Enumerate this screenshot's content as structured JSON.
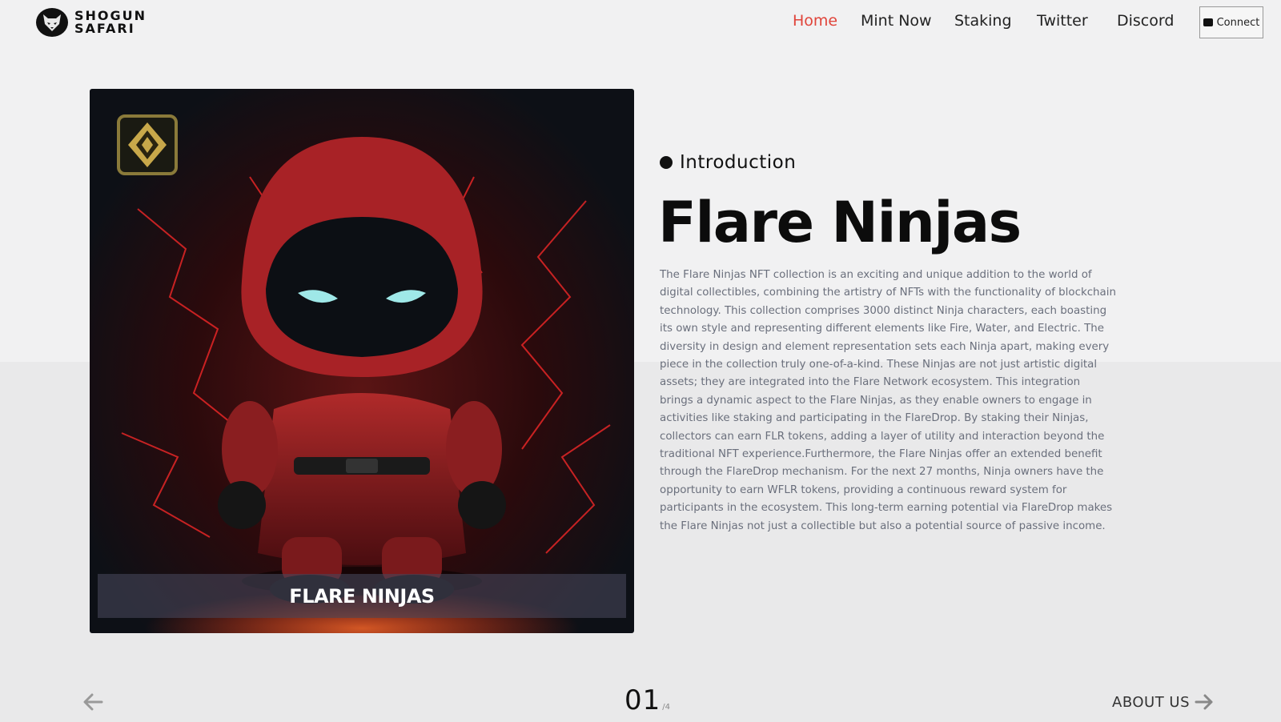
{
  "brand": {
    "line1": "SHOGUN",
    "line2": "SAFARI",
    "logo_icon": "fox-mask-icon"
  },
  "nav": {
    "items": [
      {
        "label": "Home",
        "active": true
      },
      {
        "label": "Mint Now",
        "active": false
      },
      {
        "label": "Staking",
        "active": false
      },
      {
        "label": "Twitter",
        "active": false
      },
      {
        "label": "Discord",
        "active": false
      }
    ],
    "connect_label": "Connect",
    "connect_icon": "wallet-icon",
    "active_color": "#e0443a"
  },
  "hero": {
    "caption": "FLARE NINJAS",
    "badge_icon": "diamond-emblem-icon"
  },
  "content": {
    "eyebrow": "Introduction",
    "title": "Flare Ninjas",
    "description": "The Flare Ninjas NFT collection is an exciting and unique addition to the world of digital collectibles, combining the artistry of NFTs with the functionality of blockchain technology. This collection comprises 3000 distinct Ninja characters, each boasting its own style and representing different elements like Fire, Water, and Electric. The diversity in design and element representation sets each Ninja apart, making every piece in the collection truly one-of-a-kind. These Ninjas are not just artistic digital assets; they are integrated into the Flare Network ecosystem. This integration brings a dynamic aspect to the Flare Ninjas, as they enable owners to engage in activities like staking and participating in the FlareDrop. By staking their Ninjas, collectors can earn FLR tokens, adding a layer of utility and interaction beyond the traditional NFT experience.Furthermore, the Flare Ninjas offer an extended benefit through the FlareDrop mechanism. For the next 27 months, Ninja owners have the opportunity to earn WFLR tokens, providing a continuous reward system for participants in the ecosystem. This long-term earning potential via FlareDrop makes the Flare Ninjas not just a collectible but also a potential source of passive income."
  },
  "pager": {
    "current": "01",
    "total": "/4",
    "next_label": "ABOUT US"
  }
}
